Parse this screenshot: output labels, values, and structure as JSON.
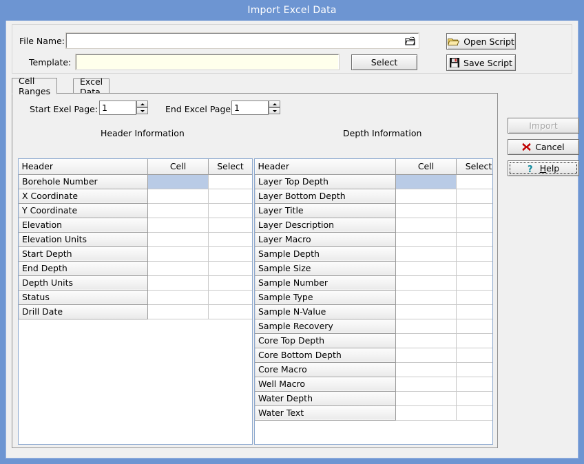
{
  "window": {
    "title": "Import Excel Data",
    "frame_color": "#6d95d2",
    "client_bg": "#f0f0f0"
  },
  "top_panel": {
    "file_name_label": "File Name:",
    "file_name_value": "",
    "file_name_placeholder": "",
    "browse_icon": "open-folder-icon",
    "template_label": "Template:",
    "template_value": "",
    "template_placeholder": "",
    "template_bg": "#ffffec",
    "select_button": "Select",
    "open_script_button": "Open Script",
    "open_script_icon": "open-folder-icon",
    "save_script_button": "Save Script",
    "save_script_icon": "floppy-disk-icon"
  },
  "tabs": [
    {
      "label": "Cell Ranges",
      "active": true
    },
    {
      "label": "Excel Data",
      "active": false
    }
  ],
  "page_range": {
    "start_label": "Start Exel Page:",
    "start_value": "1",
    "end_label": "End Excel Page:",
    "end_value": "1"
  },
  "sections": {
    "left_title": "Header Information",
    "right_title": "Depth Information"
  },
  "grid_columns": [
    "Header",
    "Cell",
    "Select"
  ],
  "header_information": {
    "rows": [
      {
        "header": "Borehole Number",
        "cell": "",
        "select": "",
        "selected": true
      },
      {
        "header": "X Coordinate",
        "cell": "",
        "select": "",
        "selected": false
      },
      {
        "header": "Y Coordinate",
        "cell": "",
        "select": "",
        "selected": false
      },
      {
        "header": "Elevation",
        "cell": "",
        "select": "",
        "selected": false
      },
      {
        "header": "Elevation Units",
        "cell": "",
        "select": "",
        "selected": false
      },
      {
        "header": "Start Depth",
        "cell": "",
        "select": "",
        "selected": false
      },
      {
        "header": "End Depth",
        "cell": "",
        "select": "",
        "selected": false
      },
      {
        "header": "Depth Units",
        "cell": "",
        "select": "",
        "selected": false
      },
      {
        "header": "Status",
        "cell": "",
        "select": "",
        "selected": false
      },
      {
        "header": "Drill Date",
        "cell": "",
        "select": "",
        "selected": false
      }
    ]
  },
  "depth_information": {
    "rows": [
      {
        "header": "Layer Top Depth",
        "cell": "",
        "select": "",
        "selected": true
      },
      {
        "header": "Layer Bottom Depth",
        "cell": "",
        "select": "",
        "selected": false
      },
      {
        "header": "Layer Title",
        "cell": "",
        "select": "",
        "selected": false
      },
      {
        "header": "Layer Description",
        "cell": "",
        "select": "",
        "selected": false
      },
      {
        "header": "Layer Macro",
        "cell": "",
        "select": "",
        "selected": false
      },
      {
        "header": "Sample Depth",
        "cell": "",
        "select": "",
        "selected": false
      },
      {
        "header": "Sample Size",
        "cell": "",
        "select": "",
        "selected": false
      },
      {
        "header": "Sample Number",
        "cell": "",
        "select": "",
        "selected": false
      },
      {
        "header": "Sample Type",
        "cell": "",
        "select": "",
        "selected": false
      },
      {
        "header": "Sample N-Value",
        "cell": "",
        "select": "",
        "selected": false
      },
      {
        "header": "Sample Recovery",
        "cell": "",
        "select": "",
        "selected": false
      },
      {
        "header": "Core Top Depth",
        "cell": "",
        "select": "",
        "selected": false
      },
      {
        "header": "Core Bottom Depth",
        "cell": "",
        "select": "",
        "selected": false
      },
      {
        "header": "Core Macro",
        "cell": "",
        "select": "",
        "selected": false
      },
      {
        "header": "Well Macro",
        "cell": "",
        "select": "",
        "selected": false
      },
      {
        "header": "Water Depth",
        "cell": "",
        "select": "",
        "selected": false
      },
      {
        "header": "Water Text",
        "cell": "",
        "select": "",
        "selected": false
      }
    ]
  },
  "actions": {
    "import_button": "Import",
    "import_enabled": false,
    "cancel_button": "Cancel",
    "cancel_icon": "red-x-icon",
    "help_button": "Help",
    "help_icon": "question-mark-icon",
    "help_focused": true
  },
  "colors": {
    "selection": "#b9cbe6",
    "title_bar": "#6d95d2",
    "grid_border": "#8da9cf"
  }
}
